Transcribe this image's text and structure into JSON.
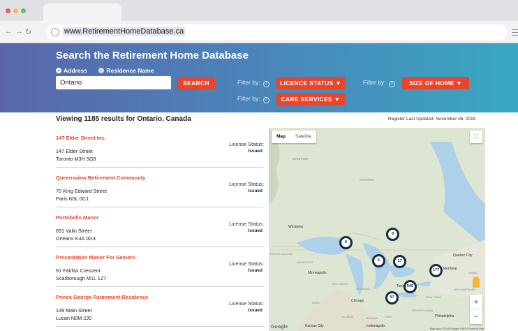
{
  "browser": {
    "url": "www.RetirementHomeDatabase.ca",
    "window_dots": [
      "#ed5e58",
      "#f5bd4f",
      "#60c454"
    ]
  },
  "search": {
    "title": "Search the Retirement Home Database",
    "radio_address": "Address",
    "radio_residence": "Residence Name",
    "input_value": "Ontario",
    "search_button": "SEARCH",
    "filter_label": "Filter by:",
    "filter_help": "?",
    "licence_status": "LICENCE STATUS ▼",
    "size_of_home": "SIZE OF HOME ▼",
    "care_services": "CARE SERVICES ▼"
  },
  "results": {
    "viewing": "Viewing 1185 results for Ontario, Canada",
    "updated": "Register Last Updated: November 06, 2019",
    "license_label": "License Status:",
    "items": [
      {
        "name": "147 Elder Street Inc.",
        "addr1": "147 Elder Street",
        "addr2": "Toronto M3H 5G9",
        "status": "Issued"
      },
      {
        "name": "Queensview Retirement Community",
        "addr1": "70 King Edward Street",
        "addr2": "Paris N3L 0C1",
        "status": "Issued"
      },
      {
        "name": "Portobello Manor",
        "addr1": "691 Valin Street",
        "addr2": "Orleans K4A 0G3",
        "status": "Issued"
      },
      {
        "name": "Presentation Manor For Seniors",
        "addr1": "61 Fairfax Crescent",
        "addr2": "Scarborough M1L 1Z7",
        "status": "Issued"
      },
      {
        "name": "Prince George Retirement Residence",
        "addr1": "139 Main Street",
        "addr2": "Lucan N0M 2J0",
        "status": "Issued"
      }
    ]
  },
  "map": {
    "tab_map": "Map",
    "tab_satellite": "Satellite",
    "fullscreen": "⛶",
    "zoom_in": "+",
    "zoom_out": "−",
    "google": "Google",
    "attribution": "Map data ©2019 Google, INEGI  Terms of Use",
    "labels": {
      "manitoba": "MANITOBA",
      "ontario": "ONTARIO",
      "winnipeg": "Winnipeg",
      "north_dakota": "NORTH DAKOTA",
      "minnesota": "MINNESOTA",
      "minneapolis": "Minneapolis",
      "wisconsin": "WISCONSIN",
      "michigan": "MICHIGAN",
      "iowa": "IOWA",
      "chicago": "Chicago",
      "toronto": "Toronto",
      "quebec_city": "Quebec City",
      "montreal": "Montreal",
      "maine": "MAINE",
      "new_york": "NEW YORK",
      "new_hampshire": "NEW HAMPSHIRE",
      "pennsylvania": "PENNSYLVANIA",
      "ohio": "OHIO",
      "indiana": "INDIANA",
      "illinois": "ILLINOIS",
      "philadelphia": "Philadelphia",
      "indianapolis": "Indianapolis",
      "kansas_city": "Kansas City"
    },
    "clusters": [
      "6",
      "9",
      "5",
      "17",
      "177",
      "545",
      "97"
    ]
  }
}
